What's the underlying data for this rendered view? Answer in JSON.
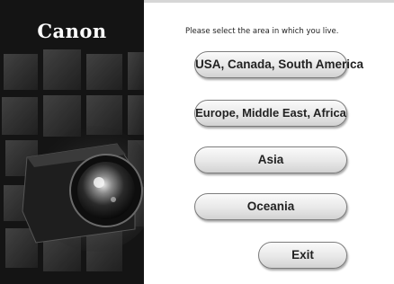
{
  "brand": {
    "logo_text": "Canon"
  },
  "instruction": "Please select the area in which you live.",
  "regions": [
    {
      "label": "USA, Canada, South America"
    },
    {
      "label": "Europe, Middle East, Africa"
    },
    {
      "label": "Asia"
    },
    {
      "label": "Oceania"
    }
  ],
  "exit_label": "Exit",
  "colors": {
    "left_panel_bg": "#141414",
    "button_border": "#7a7a7a",
    "text": "#222222"
  }
}
